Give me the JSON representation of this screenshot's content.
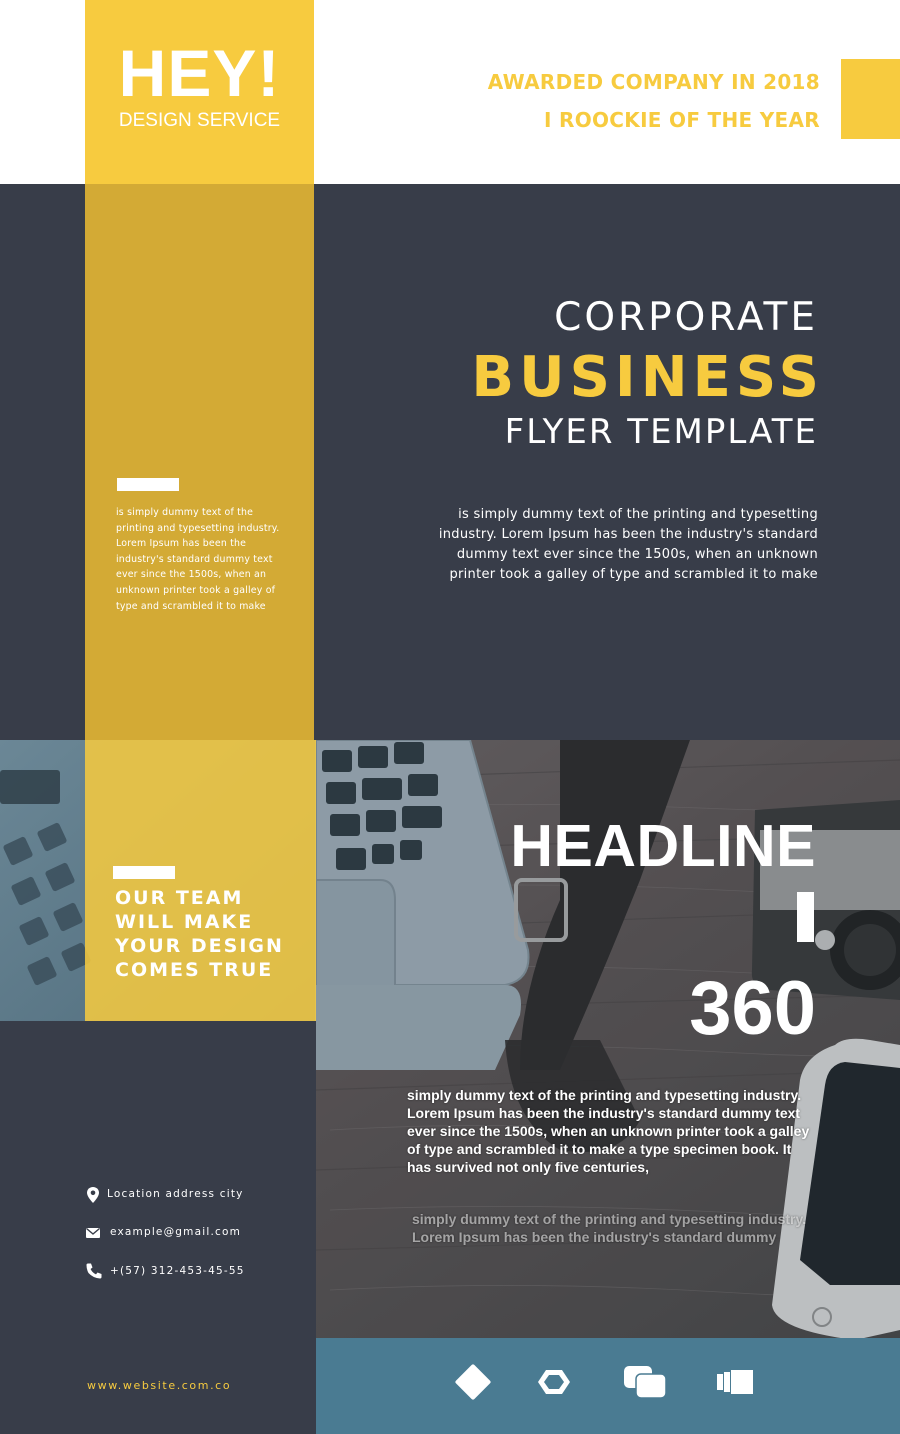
{
  "brand": {
    "logo_title": "HEY!",
    "logo_subtitle": "DESIGN SERVICE",
    "accent_color": "#f7cb3f",
    "dark_color": "#383d49",
    "strip_color": "#d3aa35",
    "band_color": "#4a7b92"
  },
  "awards": {
    "line1": "AWARDED COMPANY IN 2018",
    "line2": "I ROOCKIE OF THE YEAR"
  },
  "hero": {
    "title_line1": "CORPORATE",
    "title_line2": "BUSINESS",
    "title_line3": "FLYER TEMPLATE",
    "body": "is simply dummy text of the printing and typesetting industry. Lorem Ipsum has been the industry's standard dummy text ever since the 1500s, when an unknown printer took a galley of type and scrambled it to make",
    "strip_text": " is simply dummy text of the printing and typesetting industry. Lorem Ipsum has been the industry's standard dummy text ever since the 1500s, when an unknown printer took a galley of type and scrambled it to make"
  },
  "team": {
    "text": "OUR TEAM\nWILL MAKE\nYOUR DESIGN\nCOMES TRUE"
  },
  "feature": {
    "headline": "HEADLINE",
    "number": "360",
    "body1": " simply dummy text of the printing and typesetting industry. Lorem Ipsum has been the industry's standard dummy text ever since the 1500s, when an unknown printer took a galley of type and scrambled it to make a type specimen book. It has survived not only five centuries,",
    "body2": " simply dummy text of the printing and typesetting industry. Lorem Ipsum has been the industry's standard dummy"
  },
  "contact": {
    "location": "Location address city",
    "location_icon": "location-pin-icon",
    "email": "example@gmail.com",
    "email_icon": "envelope-icon",
    "phone": "+(57) 312-453-45-55",
    "phone_icon": "phone-icon",
    "website": "www.website.com.co"
  },
  "footer_icons": [
    "diamond-icon",
    "hexagon-icon",
    "chat-bubbles-icon",
    "stacked-cards-icon"
  ]
}
